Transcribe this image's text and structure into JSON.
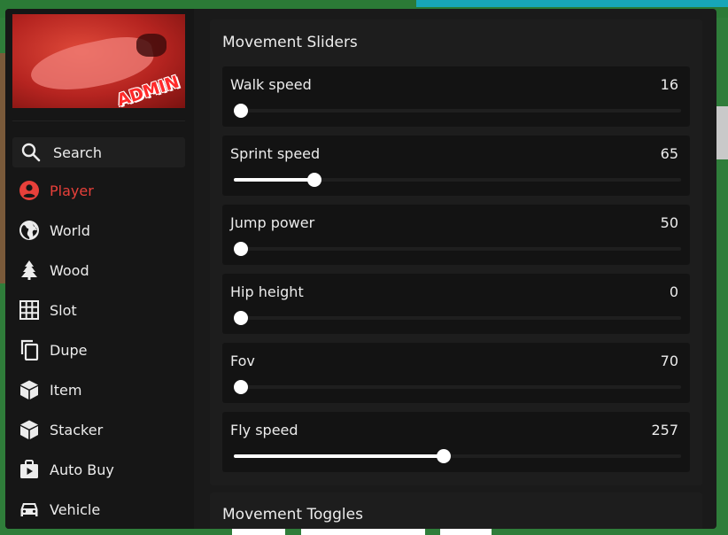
{
  "banner": {
    "text": "ADMIN"
  },
  "sidebar": {
    "items": [
      {
        "label": "Search",
        "icon": "search-icon"
      },
      {
        "label": "Player",
        "icon": "user-icon",
        "active": true
      },
      {
        "label": "World",
        "icon": "globe-icon"
      },
      {
        "label": "Wood",
        "icon": "tree-icon"
      },
      {
        "label": "Slot",
        "icon": "grid-icon"
      },
      {
        "label": "Dupe",
        "icon": "copy-icon"
      },
      {
        "label": "Item",
        "icon": "cube-icon"
      },
      {
        "label": "Stacker",
        "icon": "cube-icon"
      },
      {
        "label": "Auto Buy",
        "icon": "shopping-bag-icon"
      },
      {
        "label": "Vehicle",
        "icon": "car-icon"
      }
    ]
  },
  "main": {
    "section_title": "Movement Sliders",
    "sliders": [
      {
        "label": "Walk speed",
        "value": "16",
        "fraction": 0.0
      },
      {
        "label": "Sprint speed",
        "value": "65",
        "fraction": 0.18
      },
      {
        "label": "Jump power",
        "value": "50",
        "fraction": 0.0
      },
      {
        "label": "Hip height",
        "value": "0",
        "fraction": 0.0
      },
      {
        "label": "Fov",
        "value": "70",
        "fraction": 0.0
      },
      {
        "label": "Fly speed",
        "value": "257",
        "fraction": 0.47
      }
    ],
    "next_section_title": "Movement Toggles"
  },
  "colors": {
    "accent": "#e8403a",
    "panel": "#1a1a1a",
    "card": "#131313",
    "text": "#ececec"
  }
}
